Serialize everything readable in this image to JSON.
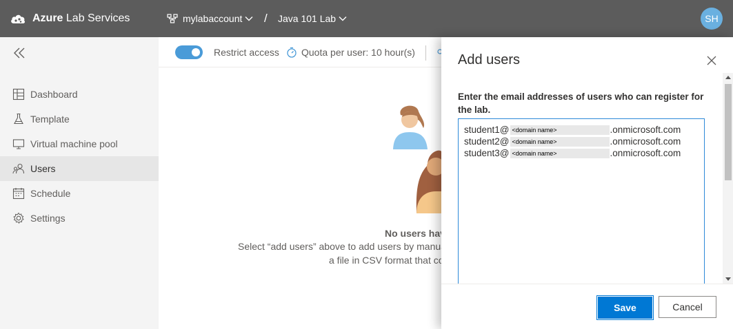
{
  "header": {
    "app_name_bold": "Azure",
    "app_name_rest": " Lab Services",
    "account": "mylabaccount",
    "separator": "/",
    "lab": "Java 101 Lab",
    "user_initials": "SH"
  },
  "sidebar": {
    "items": [
      {
        "label": "Dashboard",
        "icon": "dashboard-icon"
      },
      {
        "label": "Template",
        "icon": "flask-icon"
      },
      {
        "label": "Virtual machine pool",
        "icon": "monitor-icon"
      },
      {
        "label": "Users",
        "icon": "users-icon",
        "active": true
      },
      {
        "label": "Schedule",
        "icon": "calendar-icon"
      },
      {
        "label": "Settings",
        "icon": "gear-icon"
      }
    ]
  },
  "toolbar": {
    "restrict_on": true,
    "restrict_label": "Restrict access",
    "quota_label": "Quota per user: 10 hour(s)"
  },
  "empty_state": {
    "title": "No users have been added",
    "line1": "Select “add users” above to add users by manually entering email addresses or by uploading",
    "line2": "a file in CSV format that contains email addresses."
  },
  "panel": {
    "title": "Add users",
    "instructions": "Enter the email addresses of users who can register for the lab.",
    "emails": [
      {
        "prefix": "student1@",
        "domain": "<domain name>",
        "suffix": ".onmicrosoft.com"
      },
      {
        "prefix": "student2@",
        "domain": "<domain name>",
        "suffix": ".onmicrosoft.com"
      },
      {
        "prefix": "student3@",
        "domain": " <domain name>",
        "suffix": ".onmicrosoft.com"
      }
    ],
    "save_label": "Save",
    "cancel_label": "Cancel"
  },
  "colors": {
    "topbar": "#5c5c5c",
    "accent": "#0078d4",
    "toggle": "#4a9bd8",
    "avatar": "#6ab0e0"
  }
}
